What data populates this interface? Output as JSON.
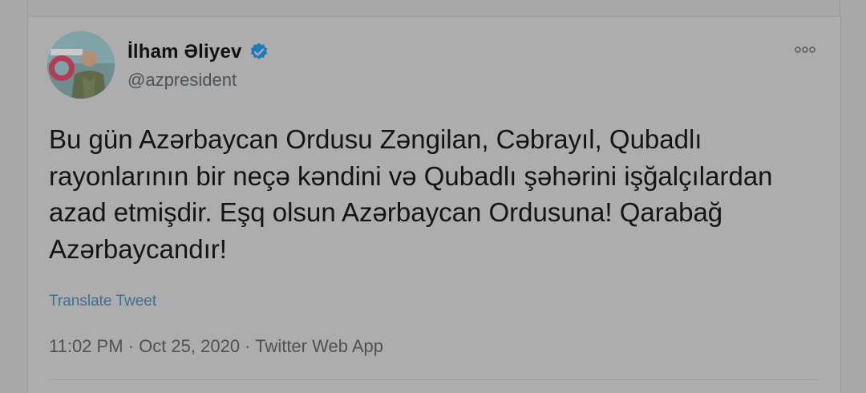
{
  "user": {
    "display_name": "İlham Əliyev",
    "handle": "@azpresident",
    "verified": true
  },
  "tweet": {
    "text": "Bu gün Azərbaycan Ordusu Zəngilan, Cəbrayıl, Qubadlı rayonlarının bir neçə kəndini və Qubadlı şəhərini işğalçılardan azad etmişdir. Eşq olsun Azərbaycan Ordusuna! Qarabağ Azərbaycandır!",
    "translate_label": "Translate Tweet",
    "timestamp": "11:02 PM · Oct 25, 2020 · Twitter Web App"
  },
  "icons": {
    "verified": "verified-badge-icon",
    "more": "more-options-icon"
  },
  "colors": {
    "verified_blue": "#1d7bbd",
    "link_blue": "#3e6f92"
  }
}
